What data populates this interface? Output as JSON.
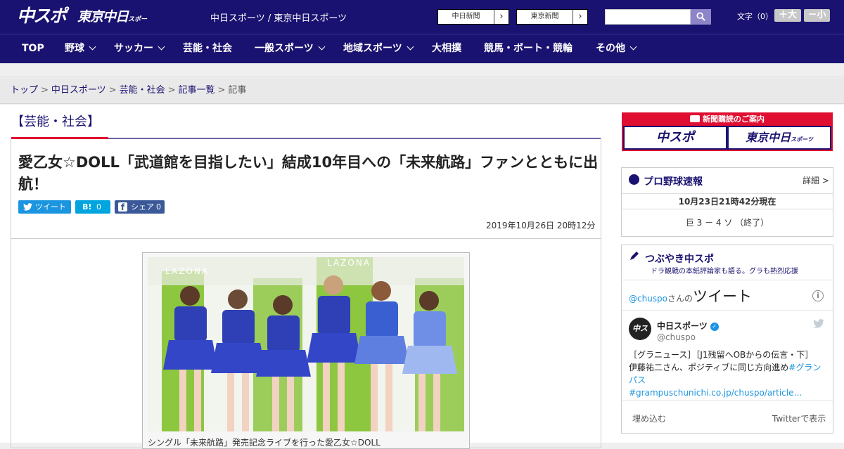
{
  "header": {
    "logo_chuspo": "中スポ",
    "logo_tokyo": "東京中日",
    "logo_tokyo_small": "スポーツ",
    "site_names": "中日スポーツ / 東京中日スポーツ",
    "paper_buttons": [
      "中日新聞",
      "東京新聞"
    ],
    "search_placeholder": "",
    "font_size_label": "文字（0）",
    "font_bigger": "＋大",
    "font_smaller": "－小"
  },
  "nav": {
    "items": [
      "TOP",
      "野球",
      "サッカー",
      "芸能・社会",
      "一般スポーツ",
      "地域スポーツ",
      "大相撲",
      "競馬・ボート・競輪",
      "その他"
    ]
  },
  "breadcrumb": {
    "items": [
      "トップ",
      "中日スポーツ",
      "芸能・社会",
      "記事一覧"
    ],
    "current": "記事",
    "separator": ">"
  },
  "article": {
    "category": "【芸能・社会】",
    "headline": "愛乙女☆DOLL「武道館を目指したい」結成10年目への「未来航路」ファンとともに出航！",
    "share": {
      "tweet": "ツイート",
      "hatena_label": "B!",
      "hatena_count": "0",
      "facebook": "シェア",
      "facebook_count": "0"
    },
    "date": "2019年10月26日 20時12分",
    "photo_sign": "LAZONA",
    "caption": "シングル「未来航路」発売記念ライブを行った愛乙女☆DOLL"
  },
  "sidebar": {
    "ad": {
      "title": "新聞購読のご案内",
      "logo_left": "中スポ",
      "logo_right": "東京中日",
      "logo_right_small": "スポーツ"
    },
    "baseball": {
      "title": "プロ野球速報",
      "more": "詳細 >",
      "as_of": "10月23日21時42分現在",
      "score": "巨 3 － 4 ソ （終了）"
    },
    "twitter": {
      "title": "つぶやき中スポ",
      "subtitle": "ドラ観戦の本紙評論家も語る。グラも熱烈応援",
      "handle": "@chuspo",
      "handle_suffix": "さんの",
      "tweets_label": "ツイート",
      "account_name": "中日スポーツ",
      "account_handle": "@chuspo",
      "avatar_text": "中スポ",
      "tweet_line1": "［グラニュース］［J1残留へOBからの伝言・下］",
      "tweet_line2_text": "伊藤祐二さん、ポジティブに同じ方向進め",
      "tweet_hashtag": "#グランパス",
      "tweet_link": "#grampuschunichi.co.jp/chuspo/article…",
      "embed": "埋め込む",
      "view_on": "Twitterで表示"
    }
  },
  "colors": {
    "header_bg": "#1a1270",
    "accent_red": "#e00e31",
    "twitter_blue": "#1b95e0",
    "facebook_blue": "#3b5998",
    "hatena_blue": "#00a4de"
  }
}
